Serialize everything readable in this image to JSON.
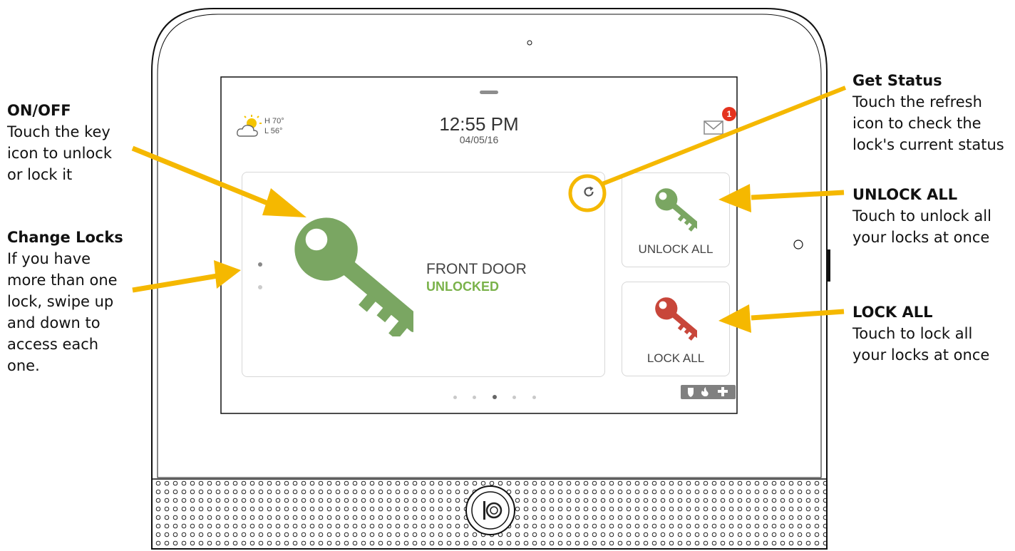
{
  "callouts": {
    "on_off": {
      "title": "ON/OFF",
      "text": "Touch the key\nicon to unlock\nor lock it"
    },
    "change_locks": {
      "title": "Change Locks",
      "text": "If you have\nmore than one\nlock, swipe up\nand down to\naccess each\none."
    },
    "get_status": {
      "title": "Get Status",
      "text": "Touch the refresh\nicon to check the\nlock's current status"
    },
    "unlock_all": {
      "title": "UNLOCK ALL",
      "text": "Touch to unlock all\nyour locks at once"
    },
    "lock_all": {
      "title": "LOCK ALL",
      "text": "Touch to lock all\nyour locks at once"
    }
  },
  "screen": {
    "weather": {
      "high": "H 70°",
      "low": "L 56°",
      "icon": "partly-sunny-icon"
    },
    "time": "12:55 PM",
    "date": "04/05/16",
    "messages": {
      "icon": "mail-icon",
      "count": "1"
    },
    "lock": {
      "name": "FRONT DOOR",
      "status": "UNLOCKED",
      "locks_count": 2,
      "selected_lock": 1
    },
    "actions": {
      "unlock_all": "UNLOCK ALL",
      "lock_all": "LOCK ALL"
    },
    "pages": {
      "total": 5,
      "current": 3
    },
    "mode_icons": [
      "shield-icon",
      "fire-icon",
      "medical-cross-icon"
    ]
  },
  "colors": {
    "arrow": "#f5b800",
    "key_unlocked": "#7aa662",
    "key_locked": "#c8463a",
    "unlocked_text": "#7ab24a",
    "badge": "#e4331f"
  }
}
